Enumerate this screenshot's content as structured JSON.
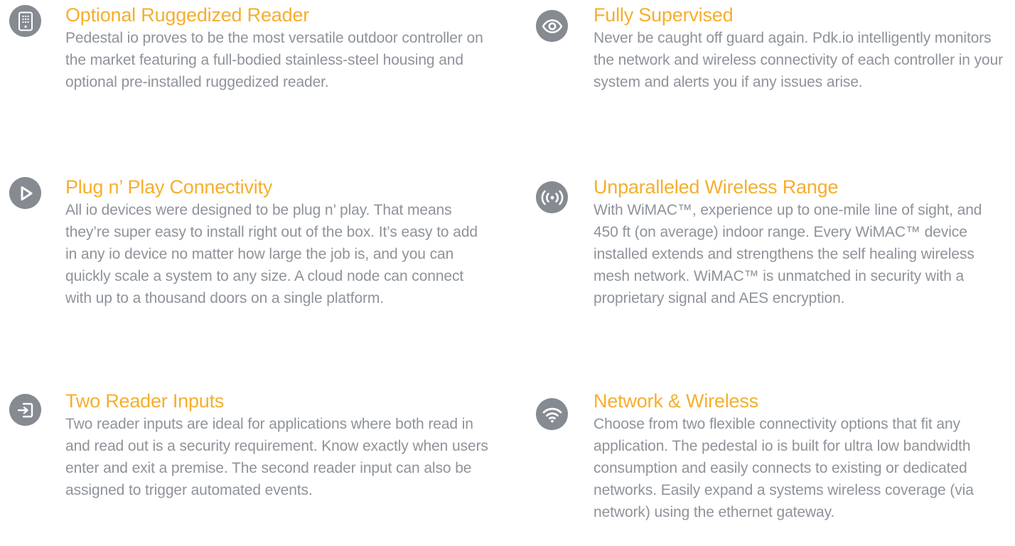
{
  "colors": {
    "accent": "#f6ae2d",
    "body_text": "#8e939a",
    "icon_background": "#868a91"
  },
  "features": {
    "left": [
      {
        "icon": "keypad-reader-icon",
        "title": "Optional Ruggedized Reader",
        "body": "Pedestal io proves to be the most versatile outdoor controller on the market featuring a full-bodied stainless-steel housing and optional pre-installed ruggedized reader."
      },
      {
        "icon": "play-icon",
        "title": "Plug n’ Play Connectivity",
        "body": "All io devices were designed to be plug n’ play. That means they’re super easy to install right out of the box. It’s easy to add in any io device no matter how large the job is, and you can quickly scale a system to any size. A cloud node can connect with up to a thousand doors on a single platform."
      },
      {
        "icon": "sign-in-icon",
        "title": "Two Reader Inputs",
        "body": "Two reader inputs are ideal for applications where both read in and read out is a security requirement. Know exactly when users enter and exit a premise. The second reader input can also be assigned to trigger automated events."
      }
    ],
    "right": [
      {
        "icon": "eye-icon",
        "title": "Fully Supervised",
        "body": "Never be caught off guard again. Pdk.io intelligently monitors the network and wireless connectivity of each controller in your system and alerts you if any issues arise."
      },
      {
        "icon": "broadcast-icon",
        "title": "Unparalleled Wireless Range",
        "body": "With WiMAC™, experience up to one-mile line of sight, and 450 ft (on average) indoor range. Every WiMAC™ device installed extends and strengthens the self healing wireless mesh network. WiMAC™ is unmatched in security with a proprietary signal and AES encryption."
      },
      {
        "icon": "wifi-icon",
        "title": "Network & Wireless",
        "body": "Choose from two flexible connectivity options that fit any application. The pedestal io is built for ultra low bandwidth consumption and easily connects to existing or dedicated networks. Easily expand a systems wireless coverage (via network) using the ethernet gateway."
      }
    ]
  }
}
